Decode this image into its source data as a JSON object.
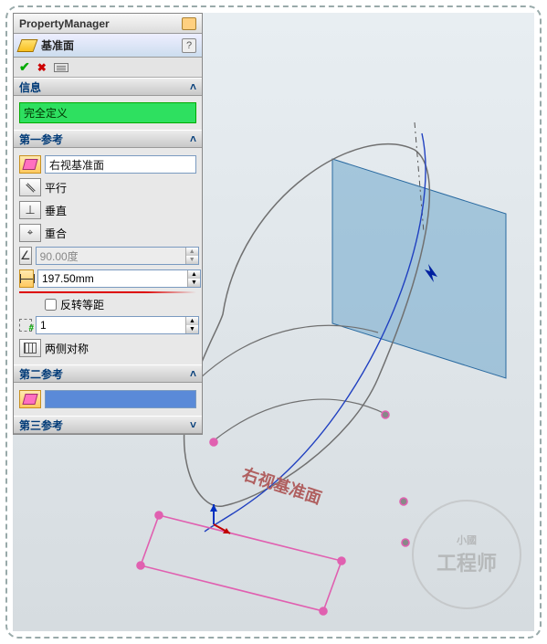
{
  "header": {
    "title": "PropertyManager"
  },
  "feature": {
    "label": "基准面",
    "help": "?"
  },
  "sections": {
    "info": {
      "title": "信息",
      "status": "完全定义"
    },
    "ref1": {
      "title": "第一参考",
      "selection": "右视基准面",
      "options": {
        "parallel": "平行",
        "perpendicular": "垂直",
        "coincident": "重合",
        "angle": "90.00度",
        "distance": "197.50mm",
        "flip": "反转等距",
        "instances": "1",
        "symmetric": "两侧对称"
      }
    },
    "ref2": {
      "title": "第二参考",
      "selection": ""
    },
    "ref3": {
      "title": "第三参考"
    }
  },
  "viewport": {
    "plane_label": "右视基准面",
    "watermark_main": "工程师",
    "watermark_sub": "小國"
  }
}
